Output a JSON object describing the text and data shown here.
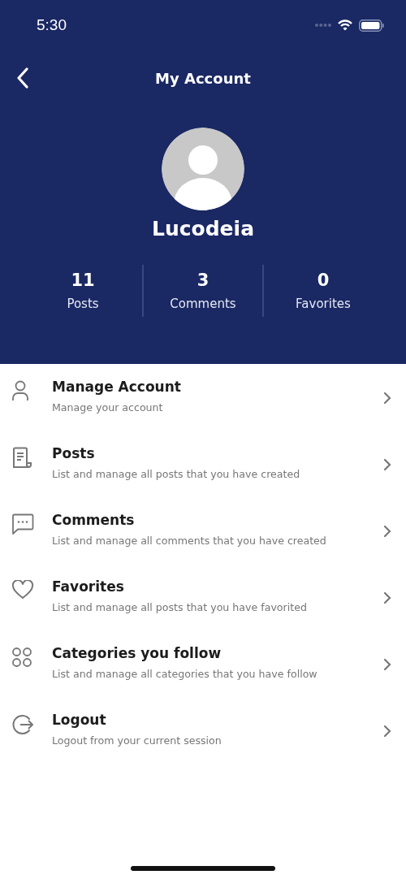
{
  "status_bar": {
    "time": "5:30"
  },
  "header": {
    "title": "My Account"
  },
  "profile": {
    "name": "Lucodeia"
  },
  "stats": [
    {
      "value": "11",
      "label": "Posts"
    },
    {
      "value": "3",
      "label": "Comments"
    },
    {
      "value": "0",
      "label": "Favorites"
    }
  ],
  "menu": [
    {
      "title": "Manage Account",
      "subtitle": "Manage your account"
    },
    {
      "title": "Posts",
      "subtitle": "List and manage all posts that you have created"
    },
    {
      "title": "Comments",
      "subtitle": "List and manage all comments that you have created"
    },
    {
      "title": "Favorites",
      "subtitle": "List and manage all posts that you have favorited"
    },
    {
      "title": "Categories you follow",
      "subtitle": "List and manage all categories that you have follow"
    },
    {
      "title": "Logout",
      "subtitle": "Logout from your current session"
    }
  ]
}
